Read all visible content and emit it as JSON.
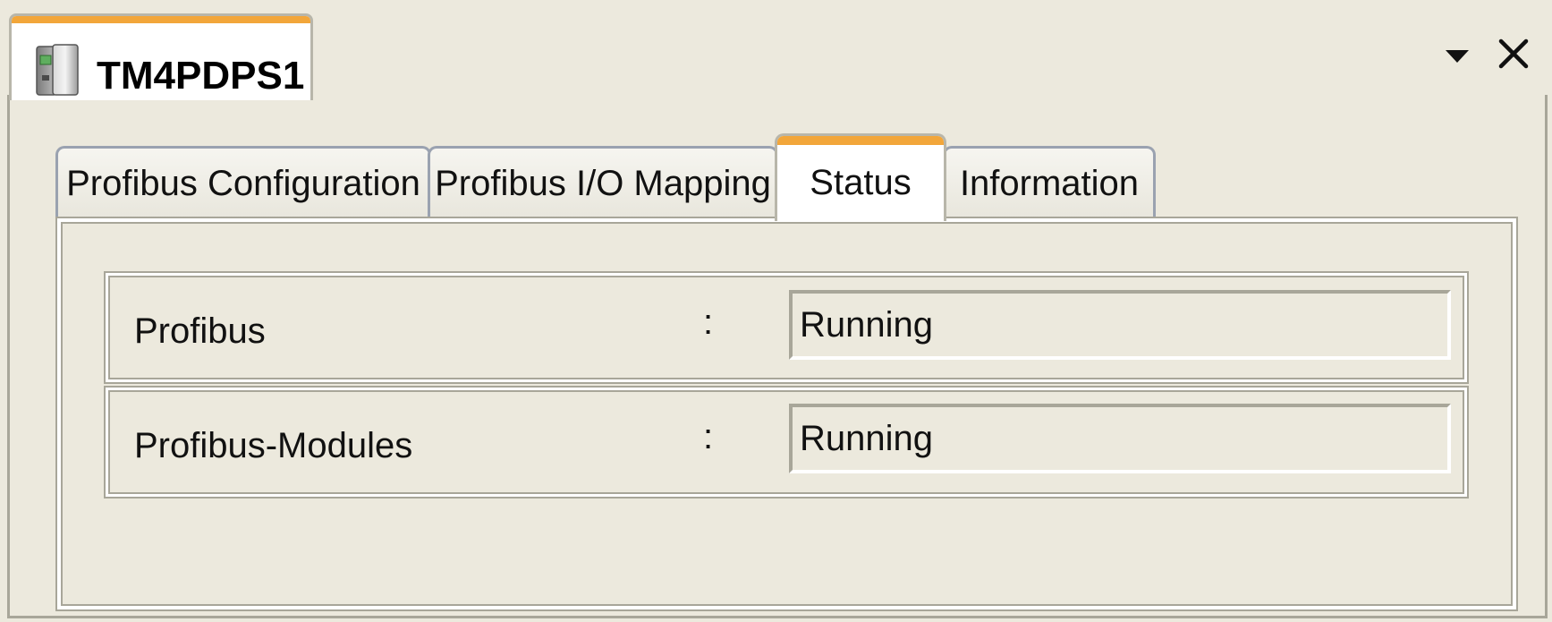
{
  "document_tab": {
    "title": "TM4PDPS1",
    "icon": "device-module-icon"
  },
  "window_controls": {
    "dropdown_icon": "dropdown-arrow-icon",
    "close_icon": "close-icon"
  },
  "tabs": [
    {
      "label": "Profibus Configuration",
      "active": false
    },
    {
      "label": "Profibus I/O Mapping",
      "active": false
    },
    {
      "label": "Status",
      "active": true
    },
    {
      "label": "Information",
      "active": false
    }
  ],
  "status": {
    "rows": [
      {
        "label": "Profibus",
        "separator": ":",
        "value": "Running"
      },
      {
        "label": "Profibus-Modules",
        "separator": ":",
        "value": "Running"
      }
    ]
  },
  "colors": {
    "background": "#ece9dd",
    "active_tab_accent": "#f2a63a",
    "border": "#a8a699"
  }
}
